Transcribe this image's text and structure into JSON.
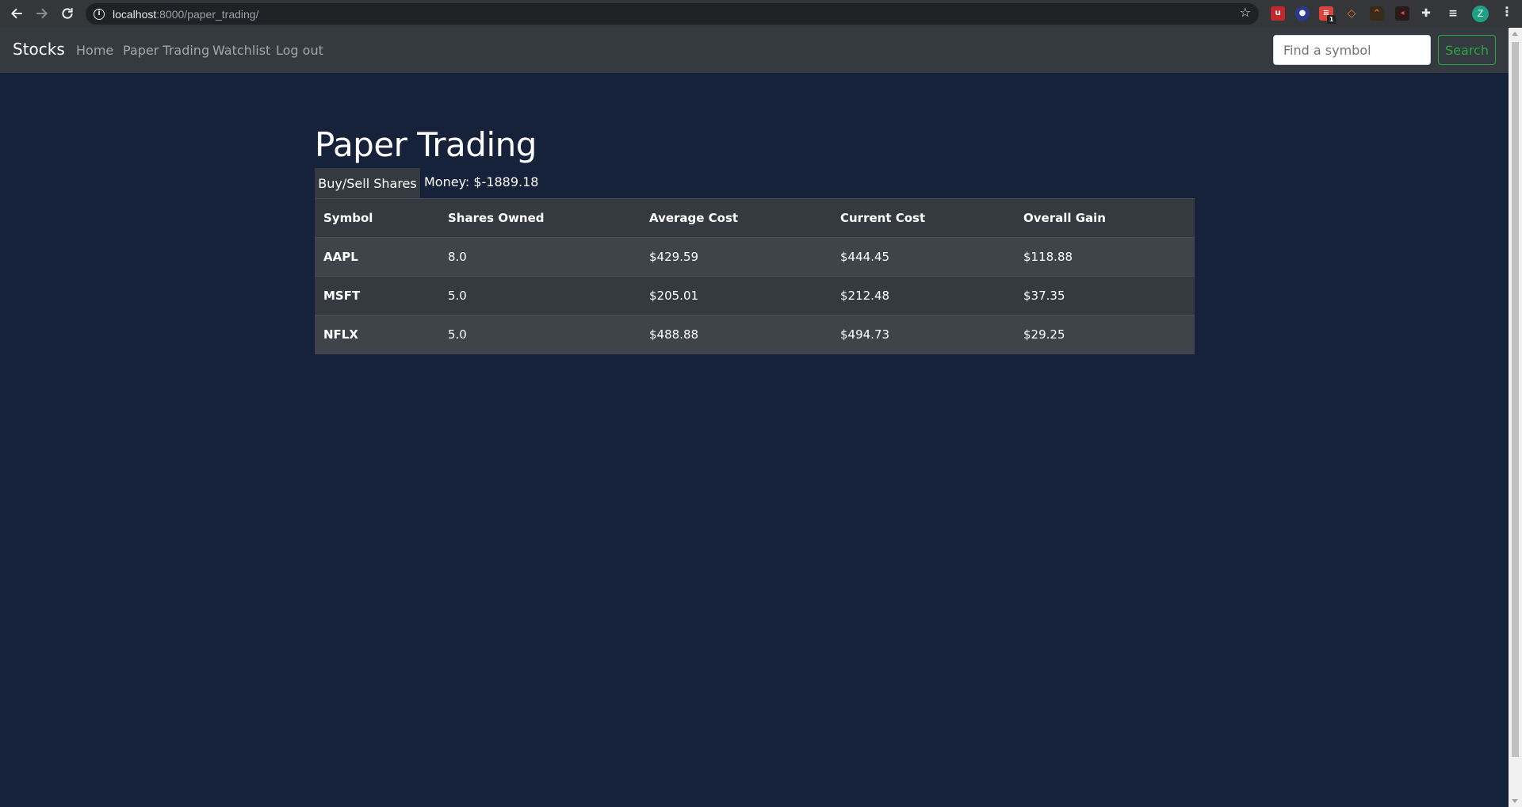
{
  "browser": {
    "url_host": "localhost",
    "url_path": ":8000/paper_trading/",
    "profile_initial": "Z",
    "extension_badge": "1"
  },
  "navbar": {
    "brand": "Stocks",
    "links": [
      "Home",
      "Paper Trading",
      "Watchlist",
      "Log out"
    ],
    "search_placeholder": "Find a symbol",
    "search_button": "Search"
  },
  "main": {
    "title": "Paper Trading",
    "trade_button": "Buy/Sell Shares",
    "money": "Money: $-1889.18"
  },
  "table": {
    "headers": [
      "Symbol",
      "Shares Owned",
      "Average Cost",
      "Current Cost",
      "Overall Gain"
    ],
    "rows": [
      [
        "AAPL",
        "8.0",
        "$429.59",
        "$444.45",
        "$118.88"
      ],
      [
        "MSFT",
        "5.0",
        "$205.01",
        "$212.48",
        "$37.35"
      ],
      [
        "NFLX",
        "5.0",
        "$488.88",
        "$494.73",
        "$29.25"
      ]
    ]
  },
  "colors": {
    "background": "#16213a",
    "navbar": "#343a40",
    "accent_green": "#28a745"
  }
}
